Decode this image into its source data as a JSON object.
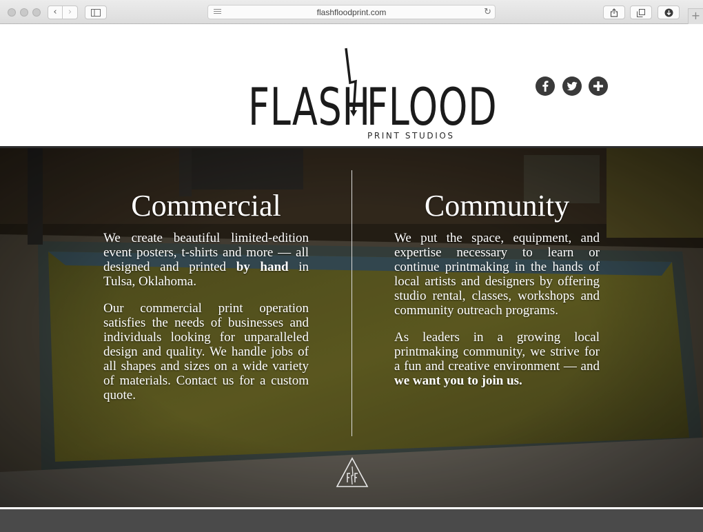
{
  "browser": {
    "url": "flashfloodprint.com",
    "icons": [
      "back-icon",
      "forward-icon",
      "sidebar-icon",
      "reader-icon",
      "reload-icon",
      "share-icon",
      "tabs-icon",
      "download-icon",
      "new-tab-icon"
    ]
  },
  "header": {
    "logo_left": "FLASH",
    "logo_right": "FLOOD",
    "logo_sub": "PRINT STUDIOS",
    "social_icons": [
      "facebook-icon",
      "twitter-icon",
      "plus-icon"
    ]
  },
  "hero": {
    "commercial": {
      "title": "Commercial",
      "p1_a": "We create beautiful limited-edition event posters, t-shirts and more — all designed and printed ",
      "p1_bold": "by hand",
      "p1_b": " in Tulsa, Oklahoma.",
      "p2": "Our commercial print operation satisfies the needs of businesses and individuals looking for unparalleled design and quality. We handle jobs of all shapes and sizes on a wide variety of materials. Contact us for a custom quote."
    },
    "community": {
      "title": "Community",
      "p1": "We put the space, equipment, and expertise necessary to learn or continue printmaking in the hands of local artists and designers by offering studio rental, classes, workshops and community outreach programs.",
      "p2_a": "As leaders in a growing local printmaking community, we strive for a fun and creative environment — and ",
      "p2_bold": "we want you to join us."
    },
    "emblem_icon": "ff-triangle-emblem-icon"
  },
  "colors": {
    "header_bg": "#ffffff",
    "logo": "#1b1b1b",
    "social_bg": "#3a3a3a",
    "hero_text": "#ffffff",
    "footer_band": "#4a4a4a"
  }
}
